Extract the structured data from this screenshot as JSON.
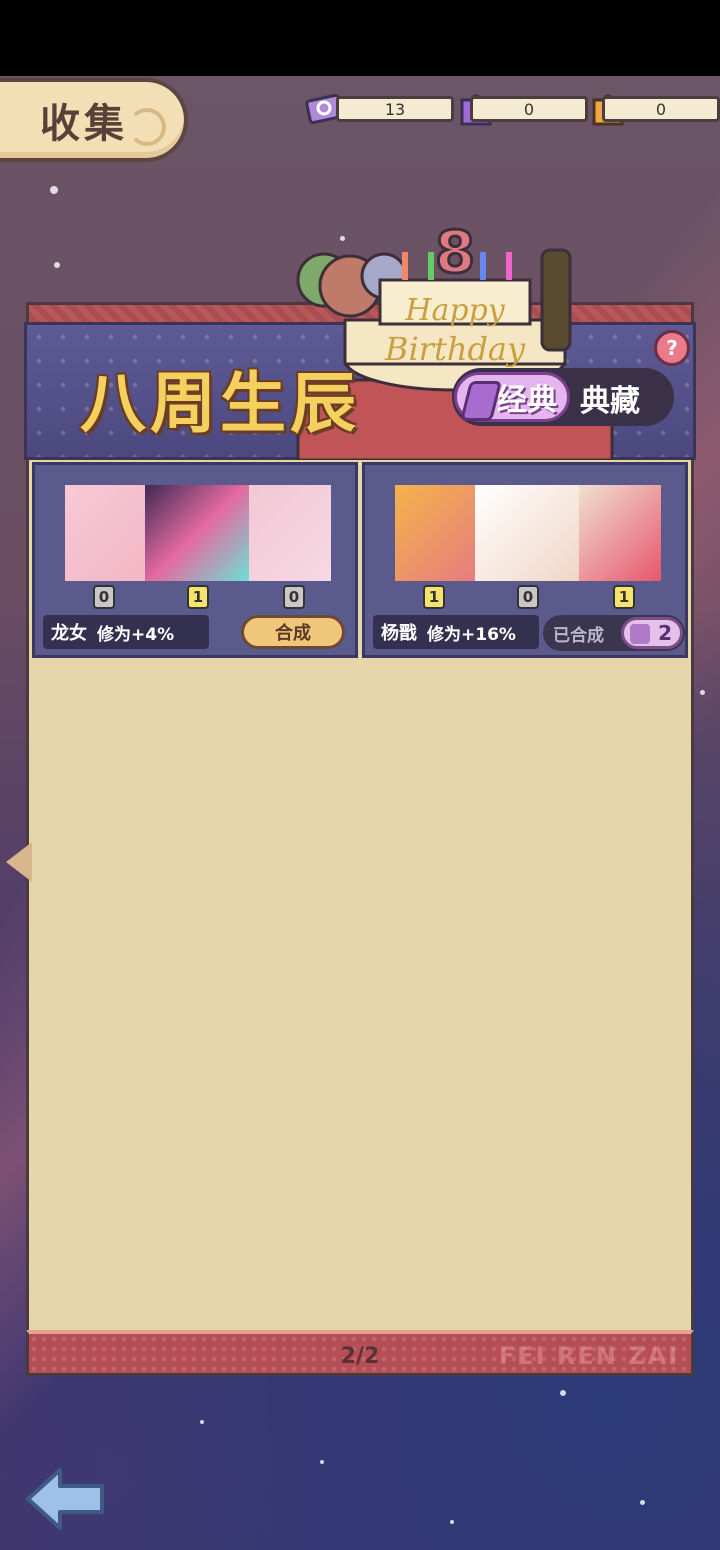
{
  "header": {
    "title": "收集"
  },
  "resources": [
    {
      "icon": "ticket-icon",
      "value": "13"
    },
    {
      "icon": "purple-puzzle-icon",
      "value": "0"
    },
    {
      "icon": "orange-puzzle-icon",
      "value": "0"
    }
  ],
  "banner": {
    "title": "八周生辰",
    "help": "?",
    "tabs": [
      {
        "label": "经典",
        "active": true
      },
      {
        "label": "典藏",
        "active": false
      }
    ]
  },
  "cards": [
    {
      "name": "龙女",
      "bonus": "修为+4%",
      "pieces": [
        "0",
        "1",
        "0"
      ],
      "action_label": "合成"
    },
    {
      "name": "杨戬",
      "bonus": "修为+16%",
      "pieces": [
        "1",
        "0",
        "1"
      ],
      "status_label": "已合成",
      "puzzle_count": "2"
    }
  ],
  "footer": {
    "page": "2/2",
    "brand": "FEI REN ZAI"
  },
  "colors": {
    "gold_title": "#f5d05f",
    "panel_bg": "#e6d6aa",
    "card_bg": "#5b5a8c",
    "accent_purple": "#e5b5ef"
  }
}
